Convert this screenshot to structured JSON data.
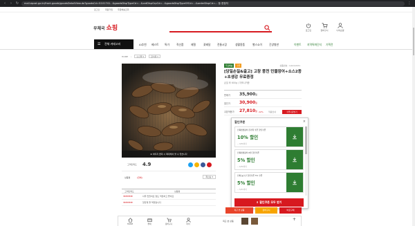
{
  "browser": {
    "url": "mall.epost.go.kr/front.goods/goodsDetailView.do?goodsCd=G101741...&goodsDispTypeCd=...&catDispGrpCd=...&goodsDispTypeOfCd=...&orderDispCd=... 등 한정자"
  },
  "util_links": [
    "로그인",
    "회원가입",
    "주문배송조회"
  ],
  "header": {
    "logo_small": "우체국",
    "logo_big": "쇼핑",
    "icons": [
      {
        "icon": "power-icon",
        "label": "로그인"
      },
      {
        "icon": "cart-icon",
        "label": "장바구니"
      },
      {
        "icon": "user-icon",
        "label": "나의쇼핑"
      }
    ]
  },
  "gnb": {
    "category_button": "전체 카테고리",
    "items": [
      "AI추천",
      "베스트",
      "특가",
      "직산품",
      "제철",
      "꽃배달",
      "전통시장",
      "생활용품",
      "별스쇼이",
      "긴양병판"
    ],
    "right_items": [
      "이벤트",
      "지역특화단지",
      "기획전"
    ]
  },
  "breadcrumb": [
    "HOME",
    "수산물",
    "장어류"
  ],
  "image_caption": "이미지 클릭 시 확대해서 볼 수 있습니다",
  "rating": {
    "label": "고객만족도",
    "score": "4.9"
  },
  "review": {
    "tab_label": "상품평",
    "count": "(전체)",
    "sort_label": "최신순",
    "col_score": "고객만족도",
    "col_review": "상품평",
    "rows": [
      {
        "stars": "★★★★★",
        "text": "너무 맛있어요 양도 적당하고 좋아요"
      },
      {
        "stars": "★★★★★",
        "text": "맛있게 잘 먹었습니다"
      }
    ]
  },
  "product": {
    "badges": [
      {
        "text": "무료배송",
        "color": "#2e7d32"
      },
      {
        "text": "쿠폰",
        "color": "#f29c1f"
      }
    ],
    "product_no": "상품번호 : G1011931",
    "title": "[당일손질&출고] 고창 풍천 민물장어+소스2종+초생강 무료증정",
    "subtitle": "손질 후 600g / 자포니카종",
    "prices": [
      {
        "label": "판매가",
        "value": "35,900",
        "unit": "원",
        "red": false
      },
      {
        "label": "할인가",
        "value": "30,900",
        "unit": "원",
        "red": true
      },
      {
        "label": "쿠폰적용가",
        "value": "27,810",
        "unit": "원",
        "red": true,
        "extra": "22%",
        "extra2": "적용안내"
      }
    ],
    "coupon_tag": "쿠폰다운받기"
  },
  "coupon_popup": {
    "title": "할인쿠폰",
    "coupons": [
      {
        "name": "전북생생장터 한가위 쿠폰 할인쿠폰",
        "rate": "10% 할인",
        "sub": "~ 9/30까지"
      },
      {
        "name": "전북생생장터 6월 할인쿠폰",
        "rate": "5% 할인",
        "sub": "~ 6/30까지"
      },
      {
        "name": "전북 농수산 할인쿠폰 5% 쿠폰",
        "rate": "5% 할인",
        "sub": "~ 5/31까지"
      }
    ],
    "download_all": "할인쿠폰 모두 받기"
  },
  "actions": {
    "recent": "최근 본 상품",
    "cart": "장바구니",
    "buy": "바로구매"
  },
  "quick_bar": {
    "items": [
      {
        "icon": "home-icon",
        "label": "HOME"
      },
      {
        "icon": "card-icon",
        "label": "결제"
      },
      {
        "icon": "cart-icon",
        "label": "장바구니"
      },
      {
        "icon": "user-icon",
        "label": "마이"
      }
    ],
    "recent_label": "최근 본 상품",
    "plus": "+"
  },
  "colors": {
    "brand": "#d7191f",
    "coupon_green": "#2e7d32",
    "cart_orange": "#f7a400"
  }
}
